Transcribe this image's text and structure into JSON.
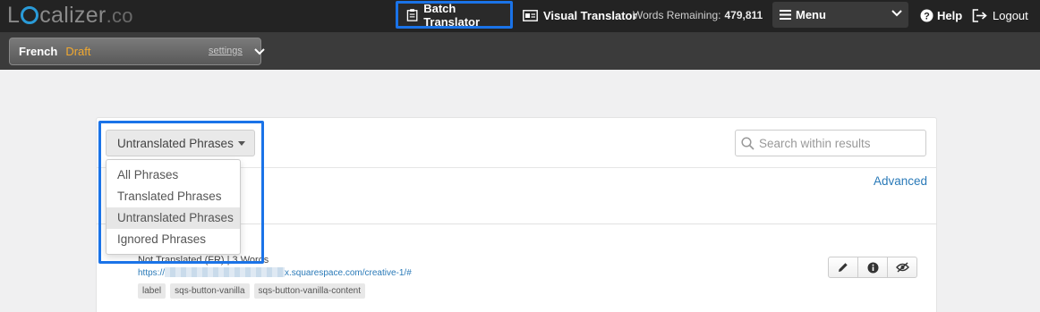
{
  "topbar": {
    "logo_prefix": "L",
    "logo_suffix": "calizer",
    "logo_co": ".co",
    "batch_translator": "Batch Translator",
    "visual_translator": "Visual Translator",
    "words_remaining_label": "Words Remaining:",
    "words_remaining_value": "479,811",
    "menu_label": "Menu",
    "help": "Help",
    "logout": "Logout"
  },
  "subbar": {
    "language": "French",
    "status": "Draft",
    "settings": "settings"
  },
  "filter": {
    "selected": "Untranslated Phrases",
    "options": [
      "All Phrases",
      "Translated Phrases",
      "Untranslated Phrases",
      "Ignored Phrases"
    ],
    "active_index": 2
  },
  "search": {
    "placeholder": "Search within results"
  },
  "advanced": "Advanced",
  "phrase": {
    "status": "Not Translated (FR) | 3 Words",
    "url_prefix": "https://",
    "url_suffix": "x.squarespace.com/creative-1/#",
    "tags": [
      "label",
      "sqs-button-vanilla",
      "sqs-button-vanilla-content"
    ]
  },
  "colors": {
    "accent": "#1a73e8",
    "draft": "#f0a830",
    "link": "#2a7ab8",
    "topbar": "#232323"
  }
}
